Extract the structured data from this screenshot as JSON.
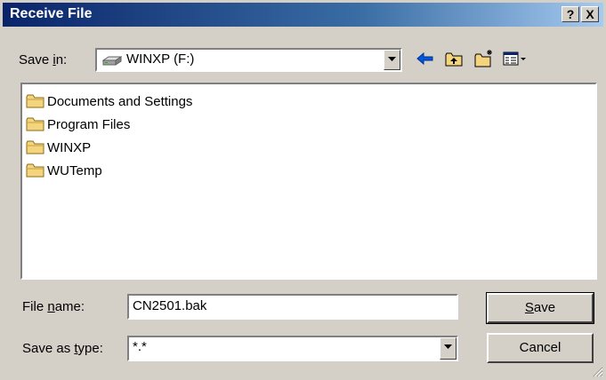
{
  "window": {
    "title": "Receive File",
    "help_label": "?",
    "close_label": "X"
  },
  "save_in": {
    "label_pre": "Save ",
    "label_key": "i",
    "label_post": "n:",
    "value": "WINXP (F:)",
    "drive_icon": "drive-icon"
  },
  "toolbar": {
    "icons": [
      "back-arrow-icon",
      "up-folder-icon",
      "new-folder-icon",
      "view-menu-icon"
    ]
  },
  "files": [
    {
      "name": "Documents and Settings",
      "icon": "folder-icon"
    },
    {
      "name": "Program Files",
      "icon": "folder-icon"
    },
    {
      "name": "WINXP",
      "icon": "folder-icon"
    },
    {
      "name": "WUTemp",
      "icon": "folder-icon"
    }
  ],
  "file_name": {
    "label_pre": "File ",
    "label_key": "n",
    "label_post": "ame:",
    "value": "CN2501.bak"
  },
  "save_type": {
    "label_pre": "Save as ",
    "label_key": "t",
    "label_post": "ype:",
    "value": "*.*"
  },
  "buttons": {
    "save_key": "S",
    "save_rest": "ave",
    "cancel": "Cancel"
  },
  "colors": {
    "title_gradient_start": "#0a246a",
    "title_gradient_end": "#a6caf0",
    "dialog_face": "#d4d0c8",
    "folder_yellow": "#f4d47c"
  }
}
